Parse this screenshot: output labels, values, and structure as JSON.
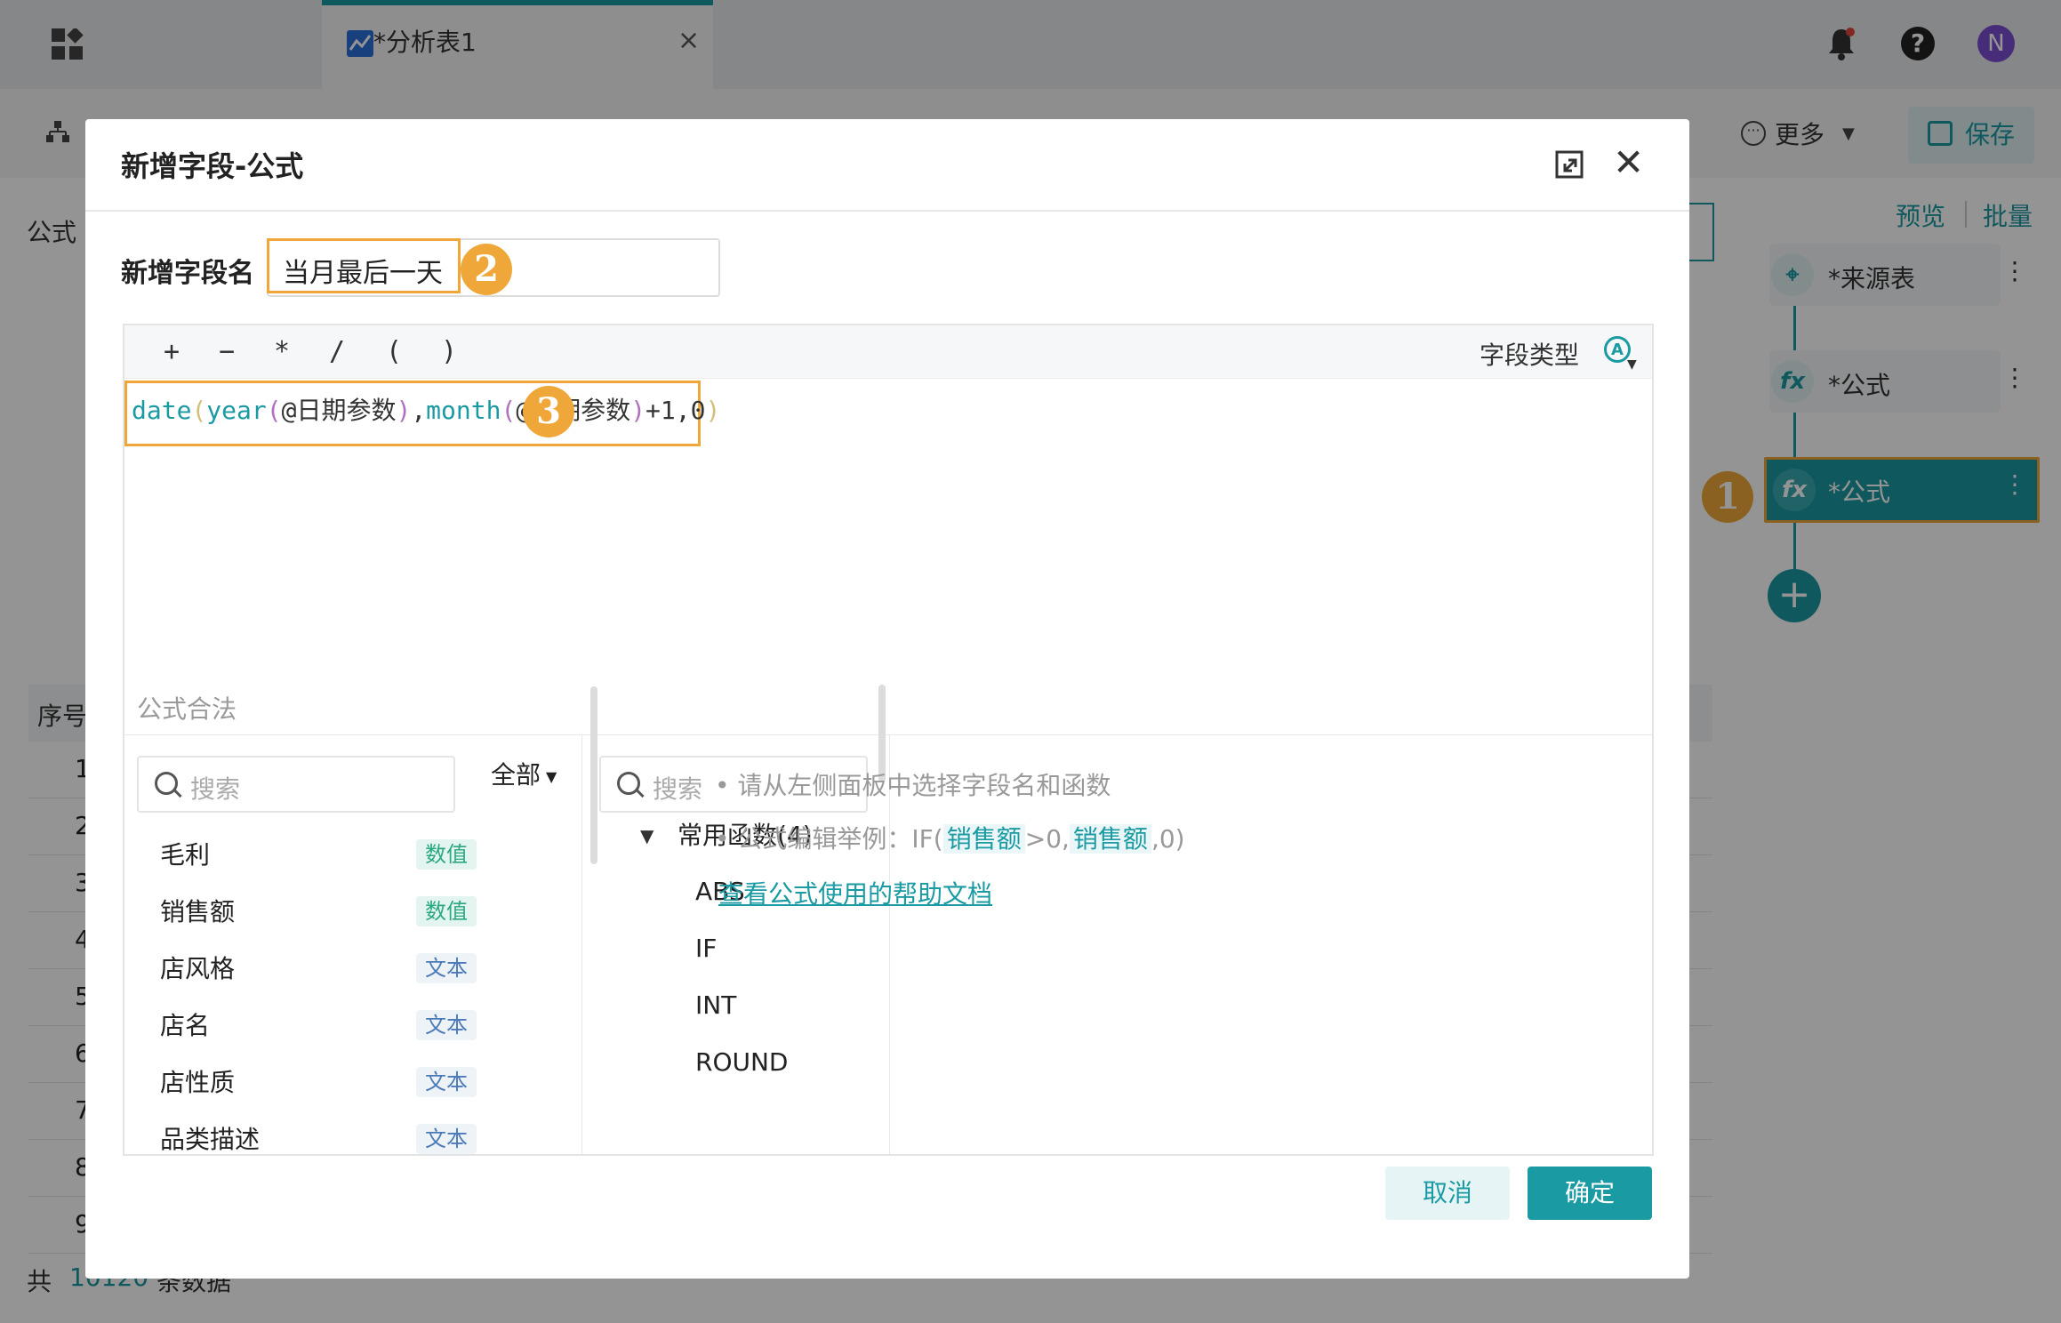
{
  "app": {
    "tab_title": "*分析表1",
    "tab_close": "×",
    "toolbar": {
      "more": "更多",
      "save": "保存"
    },
    "left_label": "公式",
    "side_links": {
      "preview": "预览",
      "batch": "批量"
    },
    "nodes": [
      {
        "label": "*来源表",
        "icon": "source-icon"
      },
      {
        "label": "*公式",
        "icon": "fx-icon"
      },
      {
        "label": "*公式",
        "icon": "fx-icon",
        "selected": true
      }
    ],
    "add_node": "+",
    "table": {
      "header_first": "序号",
      "row_numbers": [
        "1",
        "2",
        "3",
        "4",
        "5",
        "6",
        "7",
        "8",
        "9"
      ]
    },
    "footer": {
      "prefix": "共",
      "count": "10120",
      "suffix": "条数据"
    },
    "user_initial": "N"
  },
  "markers": {
    "m1": "1",
    "m2": "2",
    "m3": "3"
  },
  "dialog": {
    "title": "新增字段-公式",
    "field_name_label": "新增字段名",
    "field_name_value": "当月最后一天",
    "operators": [
      "+",
      "−",
      "*",
      "/",
      "(",
      ")"
    ],
    "field_type_label": "字段类型",
    "field_type_icon": "A",
    "formula": {
      "part1": "date",
      "p1": "(",
      "part2": "year",
      "p2": "(",
      "arg1": "@日期参数",
      "p3": ")",
      "comma1": ",",
      "part3": "month",
      "p4": "(",
      "arg2": "@日期参数",
      "p5": ")",
      "rest": "+1,0",
      "p6": ")"
    },
    "status": "公式合法",
    "left_search_placeholder": "搜索",
    "filter_all": "全部",
    "fields": [
      {
        "name": "毛利",
        "type": "数值"
      },
      {
        "name": "销售额",
        "type": "数值"
      },
      {
        "name": "店风格",
        "type": "文本"
      },
      {
        "name": "店名",
        "type": "文本"
      },
      {
        "name": "店性质",
        "type": "文本"
      },
      {
        "name": "品类描述",
        "type": "文本"
      }
    ],
    "mid_search_placeholder": "搜索",
    "fn_group": "常用函数(4)",
    "functions": [
      "ABS",
      "IF",
      "INT",
      "ROUND"
    ],
    "hint1": "• 请从左侧面板中选择字段名和函数",
    "hint2_prefix": "• 公式编辑举例：IF(",
    "hint2_hl1": "销售额",
    "hint2_mid": ">0,",
    "hint2_hl2": "销售额",
    "hint2_suffix": ",0)",
    "help_link": "查看公式使用的帮助文档",
    "cancel": "取消",
    "ok": "确定"
  },
  "colors": {
    "accent": "#1a9aa3",
    "marker": "#f0a73a"
  }
}
